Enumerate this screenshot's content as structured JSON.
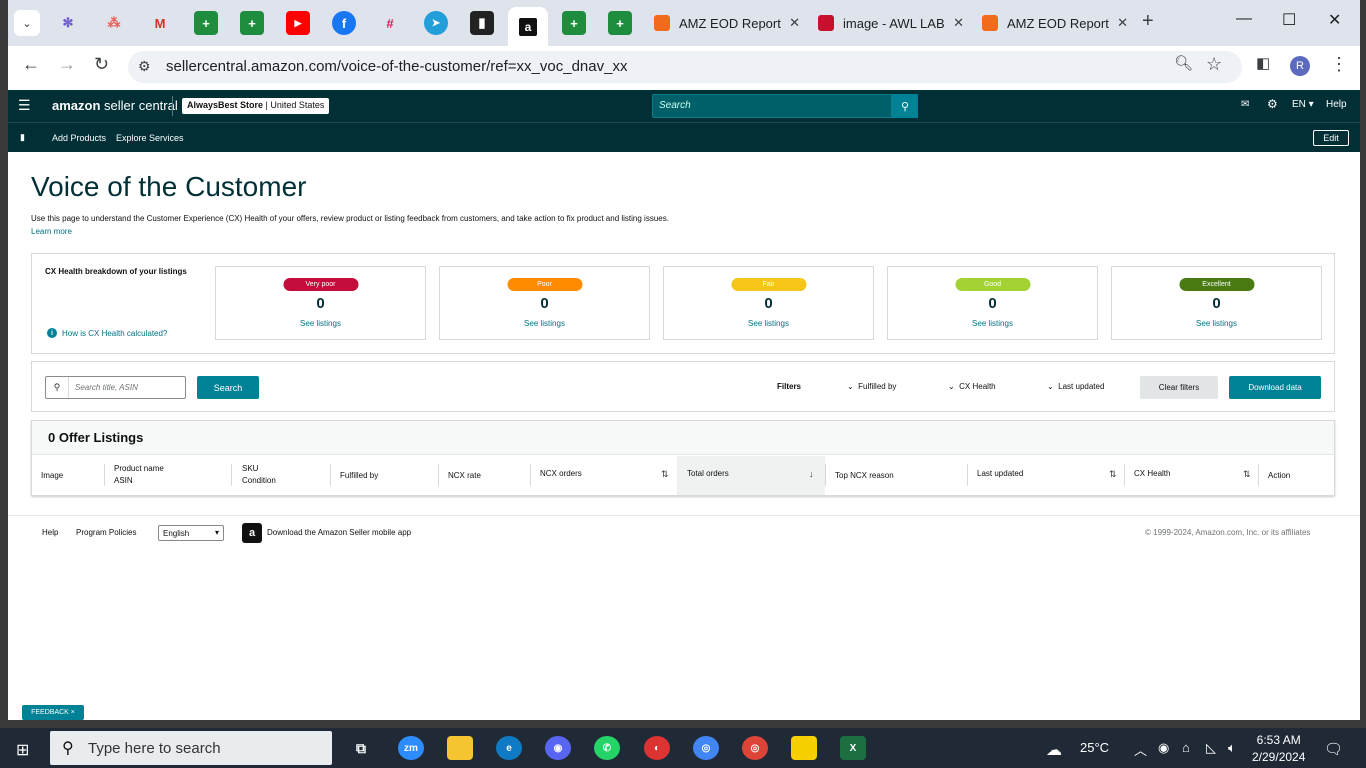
{
  "browser": {
    "tabs": [
      {
        "title": "AMZ EOD Report",
        "color": "#f26b1d"
      },
      {
        "title": "image - AWL LAB",
        "color": "#c8102e"
      },
      {
        "title": "AMZ EOD Report",
        "color": "#f26b1d"
      }
    ],
    "url": "sellercentral.amazon.com/voice-of-the-customer/ref=xx_voc_dnav_xx",
    "profile_initial": "R"
  },
  "seller_central": {
    "logo_brand": "amazon",
    "logo_text": "seller central",
    "store_name": "AlwaysBest Store",
    "store_region": "United States",
    "search_placeholder": "Search",
    "language": "EN",
    "help": "Help",
    "subnav": [
      "Add Products",
      "Explore Services"
    ],
    "edit": "Edit"
  },
  "page": {
    "title": "Voice of the Customer",
    "description": "Use this page to understand the Customer Experience (CX) Health of your offers, review product or listing feedback from customers, and take action to fix product and listing issues.",
    "learn_more": "Learn more",
    "cx_breakdown_label": "CX Health breakdown of your listings",
    "cx_how": "How is CX Health calculated?",
    "cards": [
      {
        "label": "Very poor",
        "count": "0",
        "link": "See listings",
        "color": "#c40d3c"
      },
      {
        "label": "Poor",
        "count": "0",
        "link": "See listings",
        "color": "#ff8c00"
      },
      {
        "label": "Fair",
        "count": "0",
        "link": "See listings",
        "color": "#f5c518"
      },
      {
        "label": "Good",
        "count": "0",
        "link": "See listings",
        "color": "#a4d233"
      },
      {
        "label": "Excellent",
        "count": "0",
        "link": "See listings",
        "color": "#4a7a12"
      }
    ],
    "search_placeholder": "Search title, ASIN",
    "search_button": "Search",
    "filters_label": "Filters",
    "filter_fulfilled": "Fulfilled by",
    "filter_cx": "CX Health",
    "filter_updated": "Last updated",
    "clear_filters": "Clear filters",
    "download": "Download data",
    "table_title": "0 Offer Listings",
    "columns": {
      "image": "Image",
      "product_name": "Product name",
      "asin": "ASIN",
      "sku": "SKU",
      "condition": "Condition",
      "fulfilled_by": "Fulfilled by",
      "ncx_rate": "NCX rate",
      "ncx_orders": "NCX orders",
      "total_orders": "Total orders",
      "top_ncx_reason": "Top NCX reason",
      "last_updated": "Last updated",
      "cx_health": "CX Health",
      "action": "Action"
    }
  },
  "footer": {
    "help": "Help",
    "program_policies": "Program Policies",
    "language": "English",
    "app_text": "Download the Amazon Seller mobile app",
    "copyright": "© 1999-2024, Amazon.com, Inc. or its affiliates"
  },
  "feedback": "FEEDBACK ×",
  "taskbar": {
    "search_placeholder": "Type here to search",
    "weather": "25°C",
    "time": "6:53 AM",
    "date": "2/29/2024"
  }
}
